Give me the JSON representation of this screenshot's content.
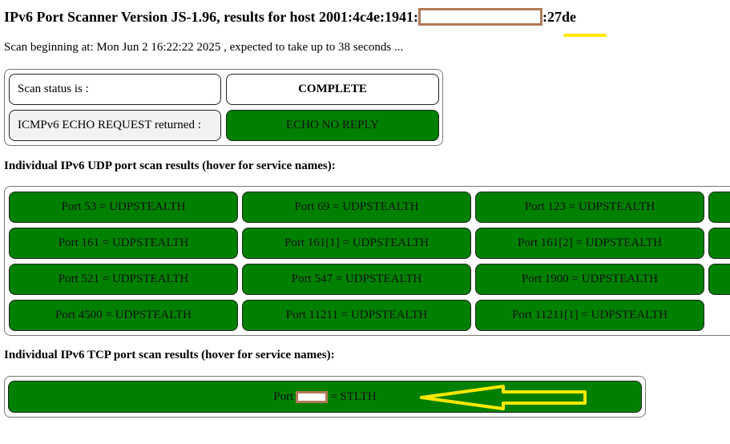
{
  "header": {
    "title_prefix": "IPv6 Port Scanner Version JS-1.96, results for host 2001:4c4e:1941:",
    "title_suffix": ":27de",
    "scan_begin_text": "Scan beginning at: Mon Jun 2 16:22:22 2025 , expected to take up to 38 seconds ..."
  },
  "status": {
    "scan_status_label": "Scan status is :",
    "scan_status_value": "COMPLETE",
    "icmp_label": "ICMPv6 ECHO REQUEST returned :",
    "icmp_value": "ECHO NO REPLY"
  },
  "udp": {
    "heading": "Individual IPv6 UDP port scan results (hover for service names):",
    "ports": [
      "Port 53 = UDPSTEALTH",
      "Port 69 = UDPSTEALTH",
      "Port 123 = UDPSTEALTH",
      "Port 161 = UDPSTEALTH",
      "Port 161[1] = UDPSTEALTH",
      "Port 161[2] = UDPSTEALTH",
      "Port 521 = UDPSTEALTH",
      "Port 547 = UDPSTEALTH",
      "Port 1900 = UDPSTEALTH",
      "Port 4500 = UDPSTEALTH",
      "Port 11211 = UDPSTEALTH",
      "Port 11211[1] = UDPSTEALTH"
    ]
  },
  "tcp": {
    "heading": "Individual IPv6 TCP port scan results (hover for service names):",
    "port_prefix": "Port",
    "port_suffix": "= STLTH"
  },
  "colors": {
    "result_green": "#008000",
    "redaction_border": "#b07a58",
    "annotation_yellow": "#ffe800"
  }
}
